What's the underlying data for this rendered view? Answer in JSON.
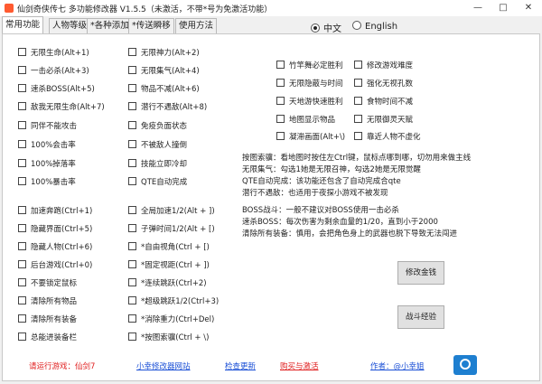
{
  "window": {
    "title": "仙剑奇侠传七 多功能修改器 V1.5.5（未激活，不带*号为免激活功能）",
    "minimize": "—",
    "maximize": "□",
    "close": "✕"
  },
  "tabs": [
    "常用功能",
    "人物等级",
    "*各种添加",
    "*传送瞬移",
    "使用方法"
  ],
  "language": {
    "options": [
      "中文",
      "English"
    ],
    "selected": "中文"
  },
  "cheats_col1": [
    "无限生命(Alt+1)",
    "一击必杀(Alt+3)",
    "速杀BOSS(Alt+5)",
    "敌我无限生命(Alt+7)",
    "同伴不能攻击",
    "100%会击率",
    "100%掉落率",
    "100%暴击率",
    "加速奔跑(Ctrl+1)",
    "隐藏界面(Ctrl+5)",
    "隐藏人物(Ctrl+6)",
    "后台游戏(Ctrl+0)",
    "不要锁定鼠标",
    "清除所有物品",
    "清除所有装备",
    "总能进装备栏"
  ],
  "cheats_col2": [
    "无限神力(Alt+2)",
    "无限集气(Alt+4)",
    "物品不减(Alt+6)",
    "潜行不遇敌(Alt+8)",
    "免疫负面状态",
    "不被敌人撞倒",
    "技能立即冷却",
    "QTE自动完成",
    "全局加速1/2(Alt + ])",
    "子弹时间1/2(Alt + [)",
    "*自由视角(Ctrl + [)",
    "*固定视距(Ctrl + ])",
    "*连续跳跃(Ctrl+2)",
    "*超级跳跃1/2(Ctrl+3)",
    "*消除重力(Ctrl+Del)",
    "*按图索骥(Ctrl + \\)"
  ],
  "cheats_col3": [
    "竹竿舞必定胜利",
    "无限隐蔽与时间",
    "天地游快速胜利",
    "地图显示物品",
    "凝滞画面(Alt+\\)"
  ],
  "cheats_col4": [
    "修改游戏难度",
    "强化无视孔数",
    "食物时间不减",
    "无限御灵天赋",
    "靠近人物不虚化"
  ],
  "notes": [
    "按图索骥：看地图时按住左Ctrl键，鼠标点哪到哪，切勿用来做主线",
    "无限集气：勾选1她是无限召神，勾选2她是无限觉醒",
    "QTE自动完成：该功能还包含了自动完成合qte",
    "潜行不遇敌：也适用于夜探小游戏不被发现",
    "BOSS战斗：一般不建议对BOSS使用一击必杀",
    "速杀BOSS：每次伤害为剩余血量的1/20，直到小于2000",
    "清除所有装备：慎用，会把角色身上的武器也脱下导致无法闯进"
  ],
  "buttons": {
    "modify_money": "修改金钱",
    "battle_exp": "战斗经验"
  },
  "footer": {
    "game_prompt": "请运行游戏：仙剑7",
    "site_link": "小幸修改器网站",
    "check_update": "检查更新",
    "buy_activate": "购买与激活",
    "author": "作者：@小幸姐"
  },
  "colors": {
    "warning": "#e02020",
    "link": "#1a4fd6"
  }
}
